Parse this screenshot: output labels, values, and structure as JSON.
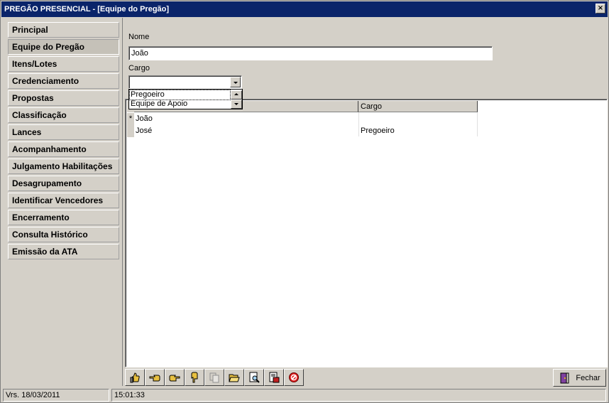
{
  "window": {
    "title": "PREGÃO PRESENCIAL - [Equipe do Pregão]",
    "close_glyph": "×"
  },
  "sidebar": {
    "items": [
      {
        "label": "Principal",
        "active": false
      },
      {
        "label": "Equipe do Pregão",
        "active": true
      },
      {
        "label": "Itens/Lotes",
        "active": false
      },
      {
        "label": "Credenciamento",
        "active": false
      },
      {
        "label": "Propostas",
        "active": false
      },
      {
        "label": "Classificação",
        "active": false
      },
      {
        "label": "Lances",
        "active": false
      },
      {
        "label": "Acompanhamento",
        "active": false
      },
      {
        "label": "Julgamento Habilitações",
        "active": false
      },
      {
        "label": "Desagrupamento",
        "active": false
      },
      {
        "label": "Identificar Vencedores",
        "active": false
      },
      {
        "label": "Encerramento",
        "active": false
      },
      {
        "label": "Consulta Histórico",
        "active": false
      },
      {
        "label": "Emissão da ATA",
        "active": false
      }
    ]
  },
  "form": {
    "nome_label": "Nome",
    "nome_value": "João",
    "cargo_label": "Cargo",
    "cargo_value": "",
    "cargo_options": [
      "Pregoeiro",
      "Equipe de Apoio"
    ]
  },
  "grid": {
    "columns": [
      "",
      "Cargo"
    ],
    "rows": [
      {
        "indicator": "*",
        "nome": "João",
        "cargo": ""
      },
      {
        "indicator": "",
        "nome": "José",
        "cargo": "Pregoeiro"
      }
    ]
  },
  "toolbar": {
    "buttons": [
      {
        "icon": "thumbs-up-icon"
      },
      {
        "icon": "point-left-icon"
      },
      {
        "icon": "point-right-icon"
      },
      {
        "icon": "point-down-icon"
      },
      {
        "icon": "copy-icon"
      },
      {
        "icon": "open-folder-icon"
      },
      {
        "icon": "search-document-icon"
      },
      {
        "icon": "export-document-icon"
      },
      {
        "icon": "cancel-icon"
      }
    ],
    "close_label": "Fechar"
  },
  "status": {
    "version": "Vrs. 18/03/2011",
    "time": "15:01:33"
  }
}
